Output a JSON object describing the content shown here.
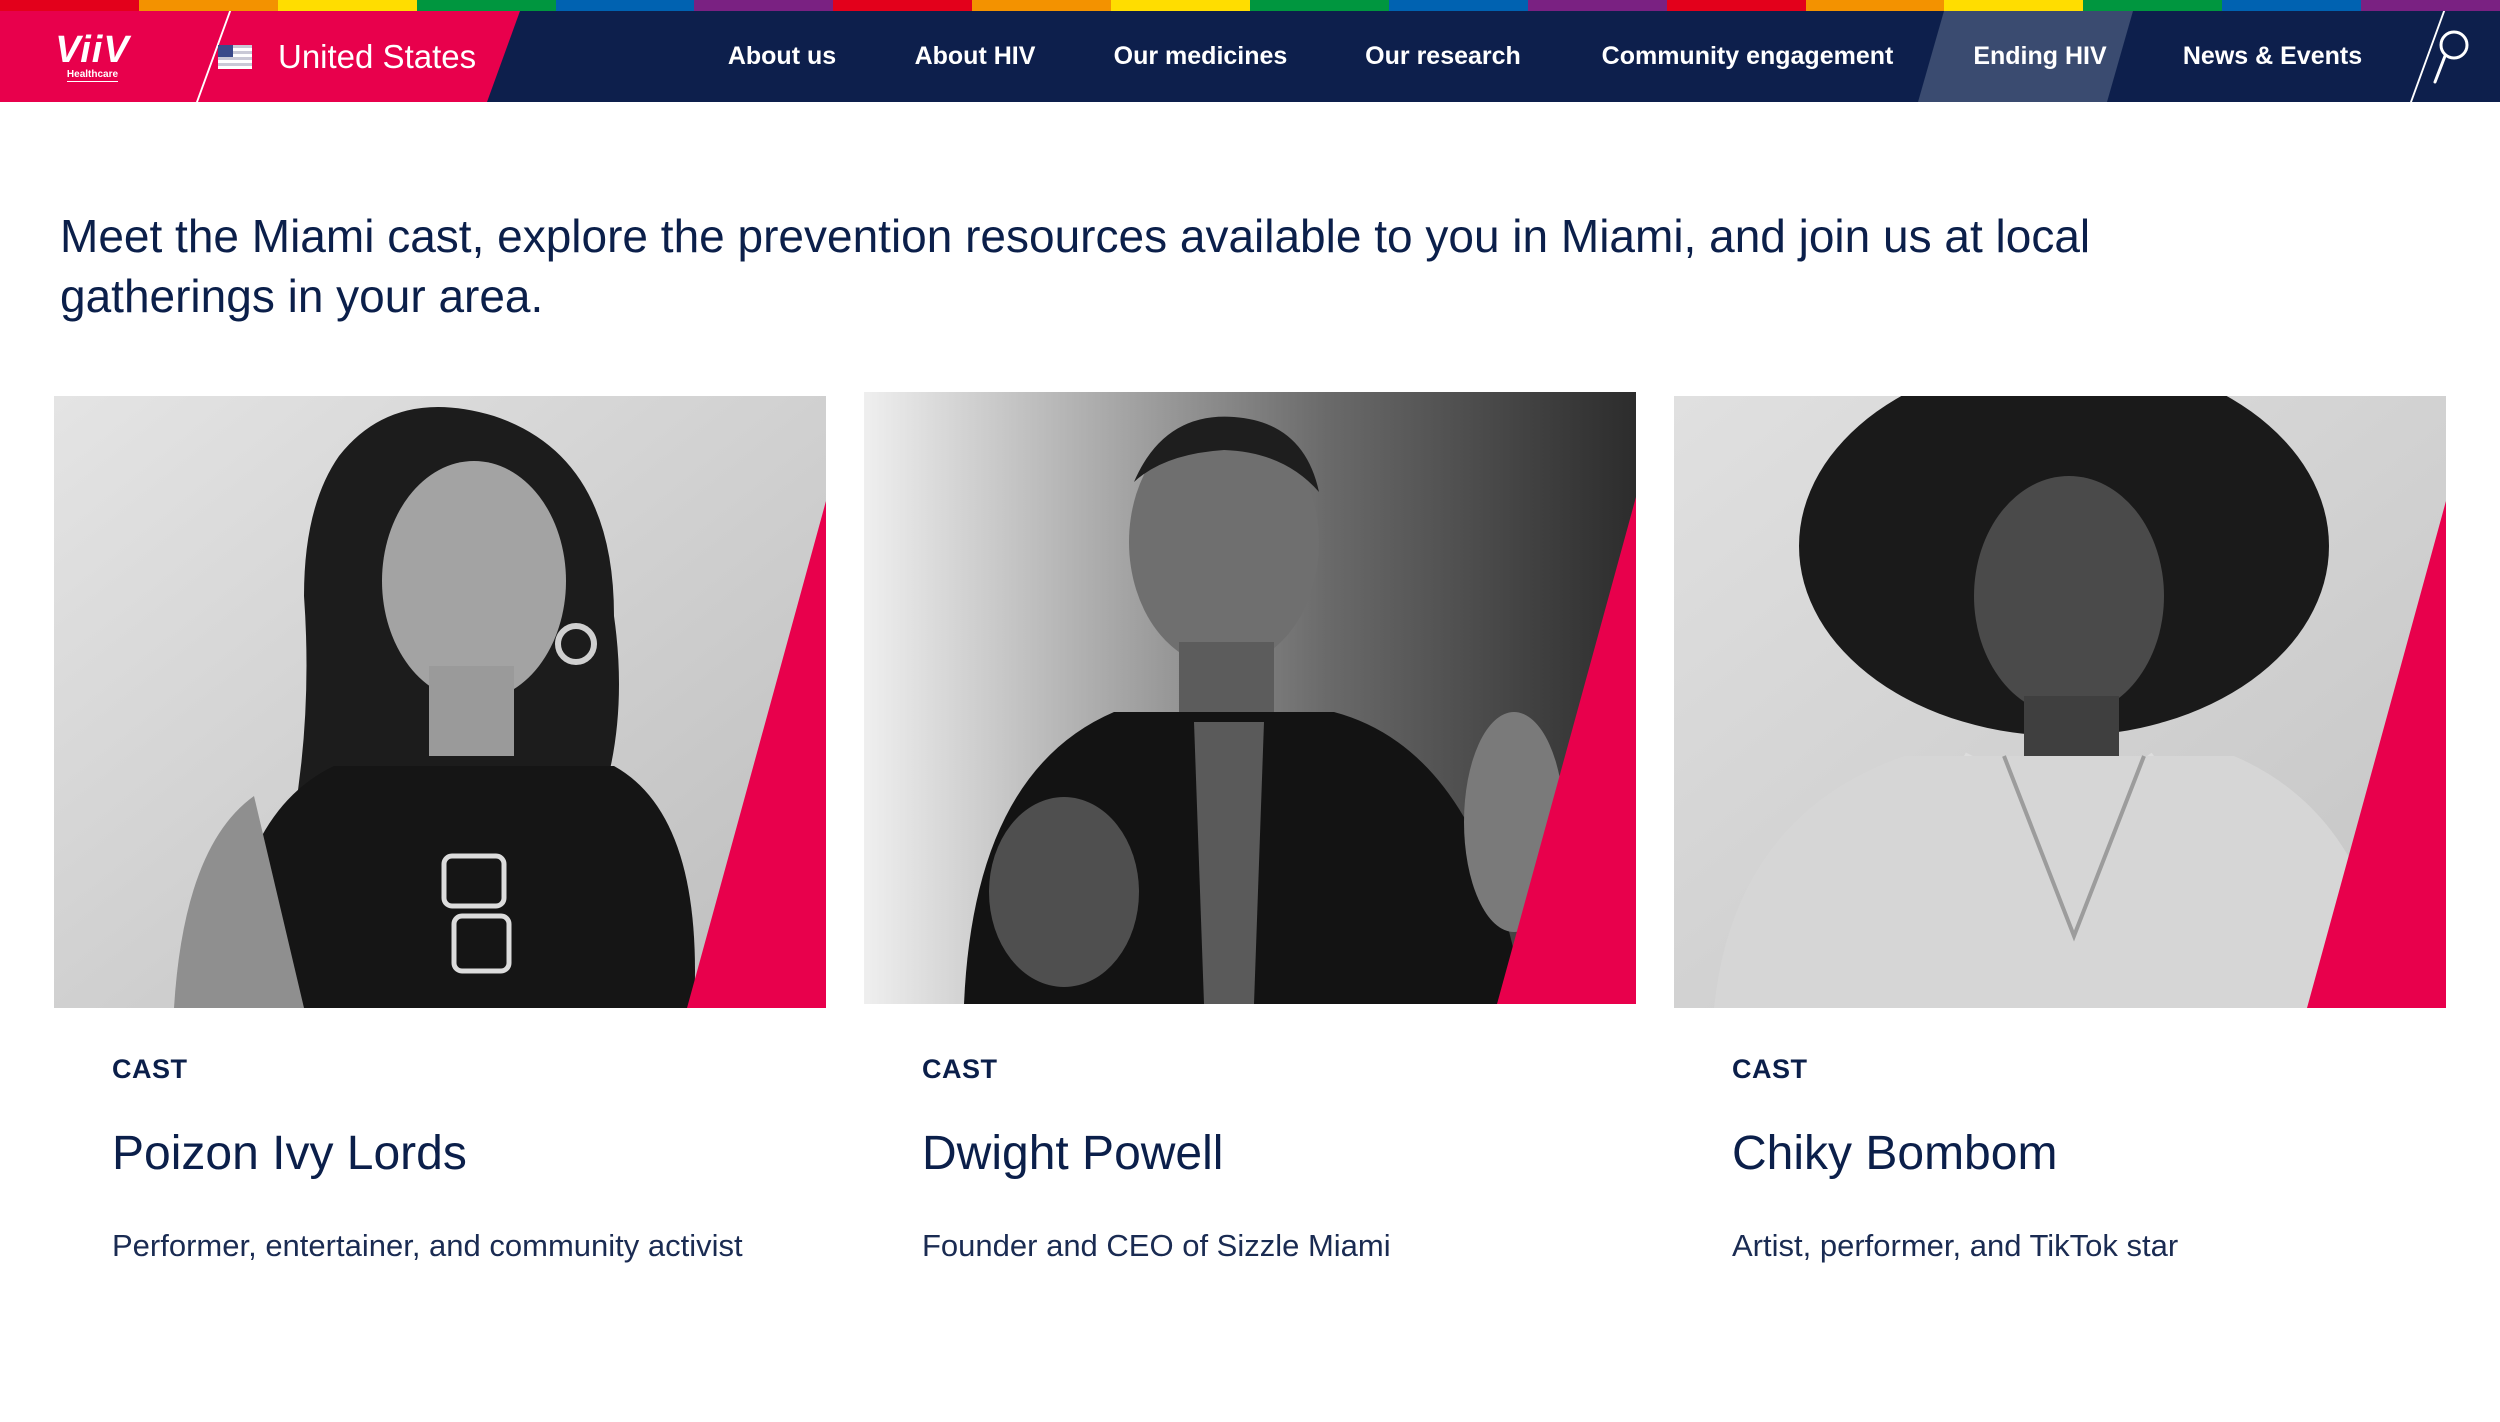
{
  "header": {
    "logo_text": "ViiV",
    "logo_subtext": "Healthcare",
    "country": "United States",
    "nav": [
      {
        "label": "About us"
      },
      {
        "label": "About HIV"
      },
      {
        "label": "Our medicines"
      },
      {
        "label": "Our research"
      },
      {
        "label": "Community engagement"
      },
      {
        "label": "Ending HIV",
        "active": true
      },
      {
        "label": "News & Events"
      }
    ],
    "search_icon": "search-icon"
  },
  "colors": {
    "navy": "#0d1f4c",
    "brand_red": "#e8004c",
    "active_nav": "#3a4b70",
    "rainbow": [
      "#e3001b",
      "#f39200",
      "#ffdd00",
      "#00963f",
      "#0062b1",
      "#7a2182"
    ]
  },
  "intro": "Meet the Miami cast, explore the prevention resources available to you in Miami, and join us at local gatherings in your area.",
  "cards": [
    {
      "kicker": "CAST",
      "name": "Poizon Ivy Lords",
      "description": "Performer, entertainer, and community activist",
      "photo_icon": "portrait-photo"
    },
    {
      "kicker": "CAST",
      "name": "Dwight Powell",
      "description": "Founder and CEO of Sizzle Miami",
      "photo_icon": "portrait-photo"
    },
    {
      "kicker": "CAST",
      "name": "Chiky Bombom",
      "description": "Artist, performer, and TikTok star",
      "photo_icon": "portrait-photo"
    }
  ]
}
